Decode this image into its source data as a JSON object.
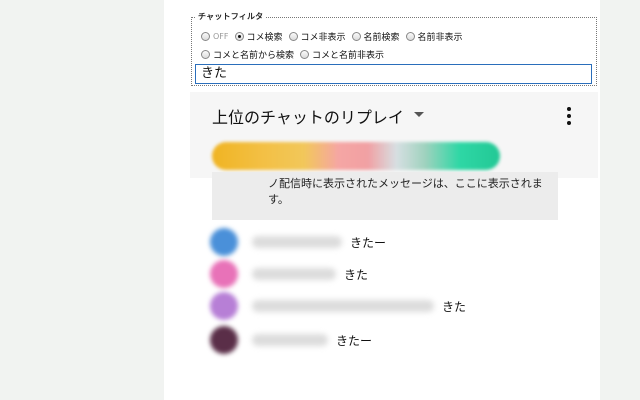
{
  "filter": {
    "legend": "チャットフィルタ",
    "options": [
      {
        "label": "OFF",
        "checked": false,
        "dim": true
      },
      {
        "label": "コメ検索",
        "checked": true,
        "dim": false
      },
      {
        "label": "コメ非表示",
        "checked": false,
        "dim": false
      },
      {
        "label": "名前検索",
        "checked": false,
        "dim": false
      },
      {
        "label": "名前非表示",
        "checked": false,
        "dim": false
      },
      {
        "label": "コメと名前から検索",
        "checked": false,
        "dim": false
      },
      {
        "label": "コメと名前非表示",
        "checked": false,
        "dim": false
      }
    ],
    "query": "きた"
  },
  "chat": {
    "title": "上位のチャットのリプレイ",
    "pinned_text": "ノ配信時に表示されたメッセージは、ここに表示されます。"
  },
  "messages": [
    {
      "text": "きたー",
      "avatar_color": "#4a90d9"
    },
    {
      "text": "きた",
      "avatar_color": "#e872b8"
    },
    {
      "text": "きた",
      "avatar_color": "#b77fd6"
    },
    {
      "text": "きたー",
      "avatar_color": "#5a2e48"
    }
  ],
  "colors": {
    "input_border": "#2a6ebb",
    "header_bg": "#f6f6f6",
    "pinned_bg": "#ececec"
  }
}
